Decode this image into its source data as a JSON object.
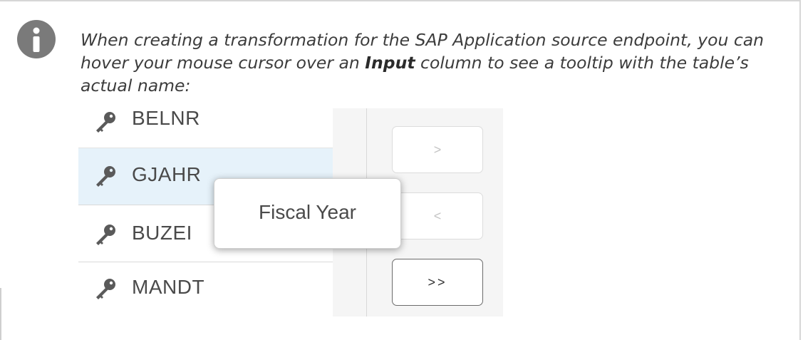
{
  "note": {
    "text_before": "When creating a transformation for the SAP Application source endpoint, you can hover your mouse cursor over an ",
    "bold_word": "Input",
    "text_after": " column to see a tooltip with the table’s actual name:",
    "icon": "info-icon"
  },
  "screenshot": {
    "columns": [
      {
        "label": "BELNR",
        "icon": "key-icon",
        "highlighted": false
      },
      {
        "label": "GJAHR",
        "icon": "key-icon",
        "highlighted": true
      },
      {
        "label": "BUZEI",
        "icon": "key-icon",
        "highlighted": false
      },
      {
        "label": "MANDT",
        "icon": "key-icon",
        "highlighted": false
      }
    ],
    "buttons": {
      "move_right": ">",
      "move_left": "<",
      "move_all": ">>"
    },
    "tooltip": "Fiscal Year",
    "colors": {
      "highlight_row": "#e6f2fa",
      "panel_bg": "#f5f5f5",
      "icon_gray": "#7a7a7a"
    }
  }
}
